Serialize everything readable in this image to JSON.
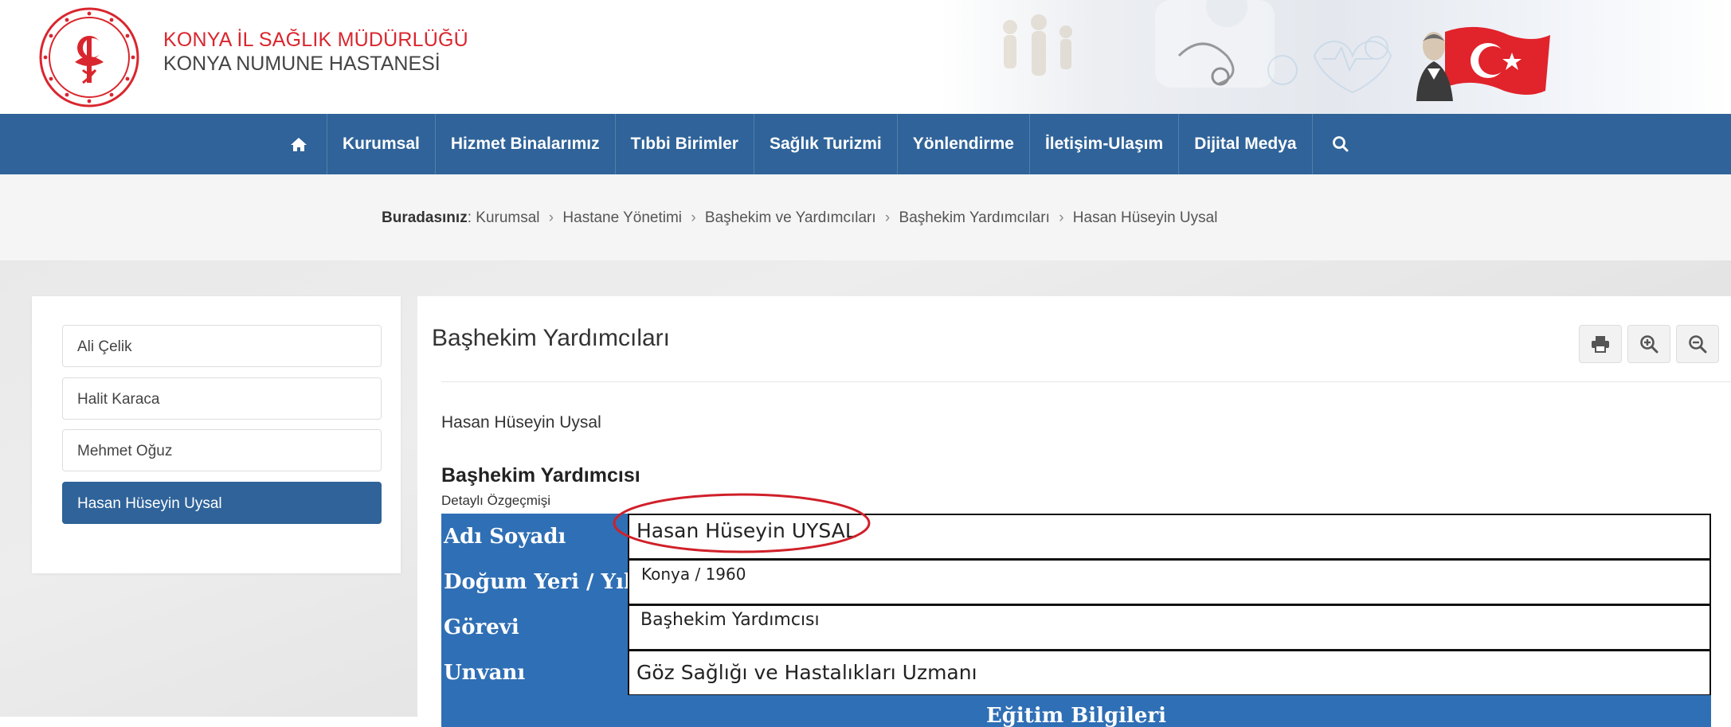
{
  "header": {
    "org_line1": "KONYA İL SAĞLIK MÜDÜRLÜĞÜ",
    "org_line2": "KONYA NUMUNE HASTANESİ",
    "accent_red": "#d9262e",
    "brand_blue": "#2f6399"
  },
  "nav": {
    "home_icon": "home-icon",
    "items": [
      {
        "label": "Kurumsal"
      },
      {
        "label": "Hizmet Binalarımız"
      },
      {
        "label": "Tıbbi Birimler"
      },
      {
        "label": "Sağlık Turizmi"
      },
      {
        "label": "Yönlendirme"
      },
      {
        "label": "İletişim-Ulaşım"
      },
      {
        "label": "Dijital Medya"
      }
    ],
    "search_icon": "search-icon"
  },
  "breadcrumb": {
    "prefix": "Buradasınız",
    "items": [
      "Kurumsal",
      "Hastane Yönetimi",
      "Başhekim ve Yardımcıları",
      "Başhekim Yardımcıları",
      "Hasan Hüseyin Uysal"
    ]
  },
  "sidebar": {
    "items": [
      {
        "label": "Ali Çelik",
        "active": false
      },
      {
        "label": "Halit Karaca",
        "active": false
      },
      {
        "label": "Mehmet Oğuz",
        "active": false
      },
      {
        "label": "Hasan Hüseyin Uysal",
        "active": true
      }
    ]
  },
  "main": {
    "title": "Başhekim Yardımcıları",
    "tools": [
      "print-icon",
      "zoom-in-icon",
      "zoom-out-icon"
    ],
    "person_name": "Hasan Hüseyin Uysal",
    "role_heading": "Başhekim Yardımcısı",
    "cv_label": "Detaylı Özgeçmişi",
    "table": {
      "rows": [
        {
          "key": "Adı Soyadı",
          "value": "Hasan Hüseyin UYSAL"
        },
        {
          "key": "Doğum Yeri / Yılı",
          "value": "Konya / 1960"
        },
        {
          "key": "Görevi",
          "value": "Başhekim Yardımcısı"
        },
        {
          "key": "Unvanı",
          "value": "Göz Sağlığı ve Hastalıkları Uzmanı"
        }
      ],
      "section_heading": "Eğitim Bilgileri"
    }
  }
}
